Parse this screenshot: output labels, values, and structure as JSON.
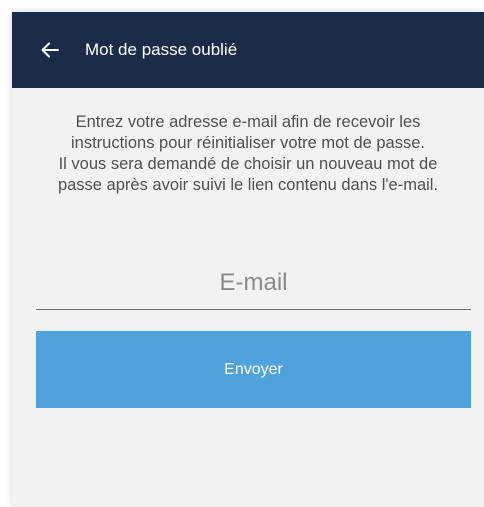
{
  "appbar": {
    "back_icon": "arrow-left-icon",
    "title": "Mot de passe oublié",
    "background": "#1c2b49"
  },
  "instructions": {
    "line1": "Entrez votre adresse e-mail afin de recevoir les",
    "line2": "instructions pour réinitialiser votre mot de passe.",
    "line3": "Il vous sera demandé de choisir un nouveau mot de",
    "line4": "passe après avoir suivi le lien contenu dans l'e-mail."
  },
  "form": {
    "email_placeholder": "E-mail",
    "email_value": "",
    "submit_label": "Envoyer",
    "submit_color": "#4fa3da"
  }
}
